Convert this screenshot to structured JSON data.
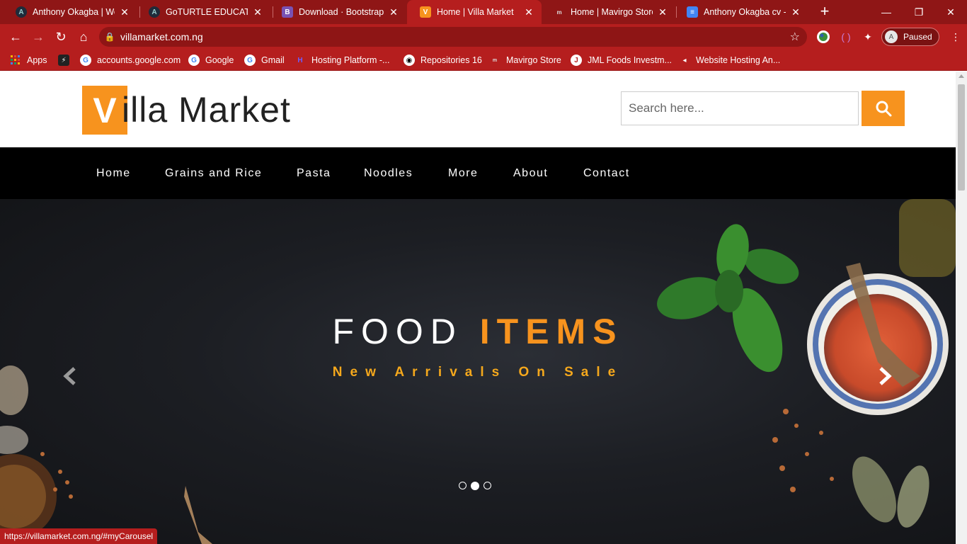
{
  "browser": {
    "tabs": [
      {
        "title": "Anthony Okagba | Web",
        "favicon": "A",
        "color": "#1f2b3a"
      },
      {
        "title": "GoTURTLE EDUCATION",
        "favicon": "A",
        "color": "#1f2b3a"
      },
      {
        "title": "Download · Bootstrap v",
        "favicon": "B",
        "color": "#7952b3"
      },
      {
        "title": "Home | Villa Market",
        "favicon": "V",
        "color": "#f7931e"
      },
      {
        "title": "Home | Mavirgo Store",
        "favicon": "m",
        "color": "#444444"
      },
      {
        "title": "Anthony Okagba cv - G",
        "favicon": "≡",
        "color": "#4285f4"
      }
    ],
    "url": "villamarket.com.ng",
    "profile_initial": "A",
    "profile_status": "Paused",
    "bookmarks": [
      {
        "label": "Apps",
        "icon": "apps-grid-icon"
      },
      {
        "label": "",
        "icon": "dark-logo-icon"
      },
      {
        "label": "accounts.google.com",
        "icon": "google-icon"
      },
      {
        "label": "Google",
        "icon": "google-icon"
      },
      {
        "label": "Gmail",
        "icon": "google-icon"
      },
      {
        "label": "Hosting Platform -...",
        "icon": "hosting-icon"
      },
      {
        "label": "Repositories 16",
        "icon": "github-icon"
      },
      {
        "label": "Mavirgo Store",
        "icon": "mavirgo-icon"
      },
      {
        "label": "JML Foods Investm...",
        "icon": "jml-icon"
      },
      {
        "label": "Website Hosting An...",
        "icon": "hosting-red-icon"
      }
    ],
    "status_url": "https://villamarket.com.ng/#myCarousel"
  },
  "site": {
    "logo_letter": "V",
    "logo_rest": "illa Market",
    "search_placeholder": "Search here...",
    "nav": [
      "Home",
      "Grains and Rice",
      "Pasta",
      "Noodles",
      "More",
      "About",
      "Contact"
    ],
    "hero_title_main": "FOOD ",
    "hero_title_accent": "ITEMS",
    "hero_subtitle": "New Arrivals On Sale",
    "carousel_active_index": 1,
    "carousel_count": 3
  },
  "colors": {
    "brand_orange": "#f7931e",
    "chrome_red": "#b51e1e",
    "subtitle_gold": "#f5a81c"
  }
}
